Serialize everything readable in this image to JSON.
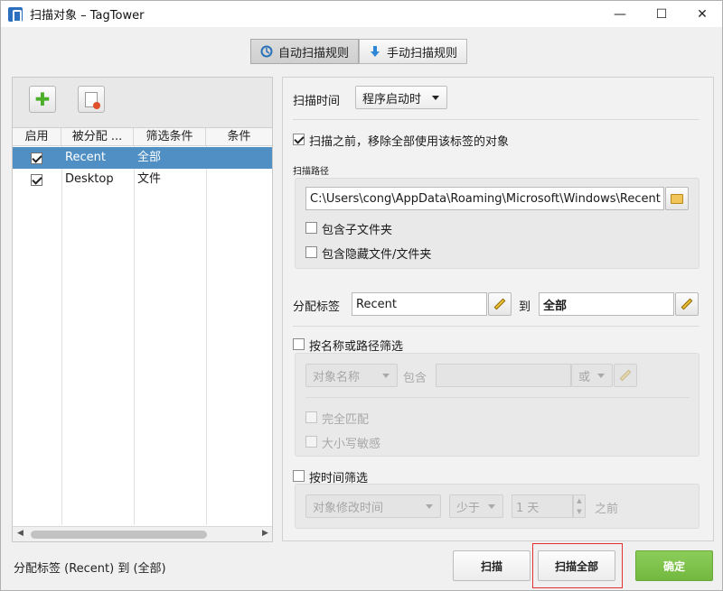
{
  "window": {
    "title": "扫描对象 – TagTower",
    "minimize": "—",
    "maximize": "☐",
    "close": "✕"
  },
  "tabs": [
    {
      "label": "自动扫描规则",
      "active": true
    },
    {
      "label": "手动扫描规则",
      "active": false
    }
  ],
  "toolbar": {
    "add_icon": "plus-icon",
    "remove_icon": "remove-document-icon"
  },
  "table": {
    "columns": [
      "启用",
      "被分配 ...",
      "筛选条件",
      "条件"
    ],
    "rows": [
      {
        "enabled": true,
        "name": "Recent",
        "filter": "全部",
        "condition": "",
        "selected": true
      },
      {
        "enabled": true,
        "name": "Desktop",
        "filter": "文件",
        "condition": "",
        "selected": false
      }
    ]
  },
  "status": "分配标签 (Recent) 到 (全部)",
  "scan_time": {
    "label": "扫描时间",
    "value": "程序启动时"
  },
  "remove_before": {
    "label": "扫描之前，移除全部使用该标签的对象",
    "checked": true
  },
  "scan_path": {
    "label": "扫描路径",
    "value": "C:\\Users\\cong\\AppData\\Roaming\\Microsoft\\Windows\\Recent",
    "include_subfolders": {
      "label": "包含子文件夹",
      "checked": false
    },
    "include_hidden": {
      "label": "包含隐藏文件/文件夹",
      "checked": false
    }
  },
  "assign": {
    "label": "分配标签",
    "tag": "Recent",
    "to": "到",
    "target": "全部"
  },
  "name_filter": {
    "label": "按名称或路径筛选",
    "checked": false,
    "field": "对象名称",
    "contains": "包含",
    "value": "",
    "op": "或",
    "exact": {
      "label": "完全匹配",
      "checked": false
    },
    "case": {
      "label": "大小写敏感",
      "checked": false
    }
  },
  "time_filter": {
    "label": "按时间筛选",
    "checked": false,
    "field": "对象修改时间",
    "cmp": "少于",
    "amount": "1 天",
    "suffix": "之前"
  },
  "buttons": {
    "scan": "扫描",
    "scan_all": "扫描全部",
    "ok": "确定"
  },
  "colors": {
    "selection": "#4f8fc4",
    "ok_button": "#7cc04a",
    "highlight": "#e03030"
  }
}
